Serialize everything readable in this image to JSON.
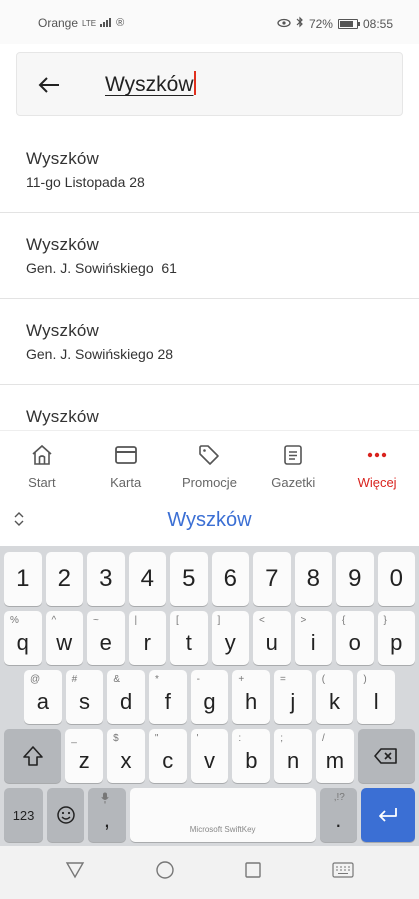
{
  "status_bar": {
    "carrier": "Orange",
    "network": "LTE",
    "battery": "72%",
    "battery_level": 0.72,
    "time": "08:55"
  },
  "search": {
    "value": "Wyszków"
  },
  "results": [
    {
      "city": "Wyszków",
      "street": "11-go Listopada 28"
    },
    {
      "city": "Wyszków",
      "street": "Gen. J. Sowińskiego  61"
    },
    {
      "city": "Wyszków",
      "street": "Gen. J. Sowińskiego 28"
    },
    {
      "city": "Wyszków",
      "street": ""
    }
  ],
  "bottom_nav": {
    "items": [
      {
        "label": "Start",
        "icon": "home-icon"
      },
      {
        "label": "Karta",
        "icon": "card-icon"
      },
      {
        "label": "Promocje",
        "icon": "tag-icon"
      },
      {
        "label": "Gazetki",
        "icon": "newspaper-icon"
      },
      {
        "label": "Więcej",
        "icon": "more-dots-icon",
        "active": true
      }
    ]
  },
  "suggestion": {
    "word": "Wyszków"
  },
  "keyboard": {
    "numbers": [
      "1",
      "2",
      "3",
      "4",
      "5",
      "6",
      "7",
      "8",
      "9",
      "0"
    ],
    "row_q": [
      {
        "k": "q",
        "s": "%"
      },
      {
        "k": "w",
        "s": "^"
      },
      {
        "k": "e",
        "s": "~"
      },
      {
        "k": "r",
        "s": "|"
      },
      {
        "k": "t",
        "s": "["
      },
      {
        "k": "y",
        "s": "]"
      },
      {
        "k": "u",
        "s": "<"
      },
      {
        "k": "i",
        "s": ">"
      },
      {
        "k": "o",
        "s": "{"
      },
      {
        "k": "p",
        "s": "}"
      }
    ],
    "row_a": [
      {
        "k": "a",
        "s": "@"
      },
      {
        "k": "s",
        "s": "#"
      },
      {
        "k": "d",
        "s": "&"
      },
      {
        "k": "f",
        "s": "*"
      },
      {
        "k": "g",
        "s": "-"
      },
      {
        "k": "h",
        "s": "+"
      },
      {
        "k": "j",
        "s": "="
      },
      {
        "k": "k",
        "s": "("
      },
      {
        "k": "l",
        "s": ")"
      }
    ],
    "row_z": [
      {
        "k": "z",
        "s": "_"
      },
      {
        "k": "x",
        "s": "$"
      },
      {
        "k": "c",
        "s": "\""
      },
      {
        "k": "v",
        "s": "'"
      },
      {
        "k": "b",
        "s": ":"
      },
      {
        "k": "n",
        "s": ";"
      },
      {
        "k": "m",
        "s": "/"
      }
    ],
    "num_switch": "123",
    "comma": ",",
    "period": ".",
    "period_sub": ",!?",
    "space_label": "Microsoft SwiftKey"
  },
  "colors": {
    "accent_red": "#d9231e",
    "suggestion_blue": "#3b6fd4",
    "enter_blue": "#3b6fd4"
  }
}
